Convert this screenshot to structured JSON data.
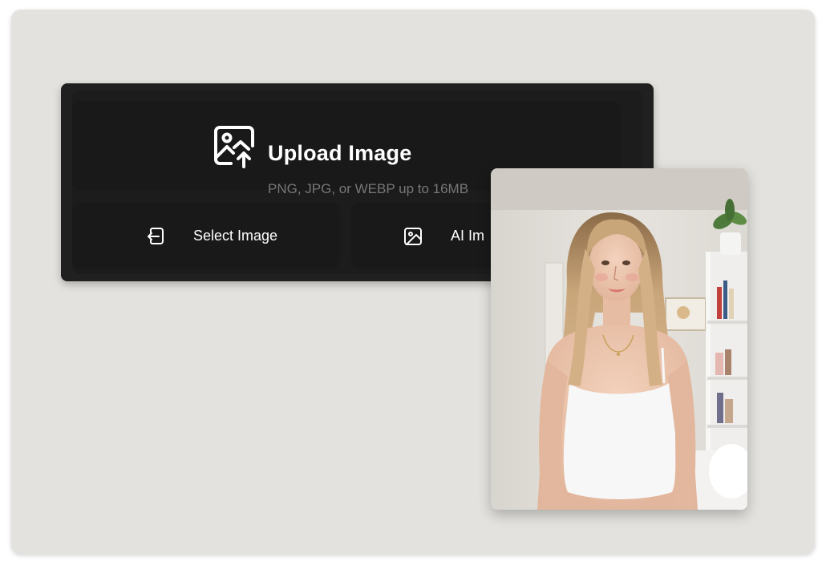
{
  "upload": {
    "title": "Upload Image",
    "subtitle": "PNG, JPG, or WEBP up to 16MB",
    "icon": "image-upload-icon"
  },
  "actions": {
    "select_label": "Select Image",
    "select_icon": "file-import-icon",
    "ai_label": "AI Im",
    "ai_icon": "image-icon"
  },
  "preview": {
    "alt": "Example photo of a woman in a white crop top",
    "accent_colors": {
      "background": "#e3e2de",
      "panel": "#202020",
      "card": "#191919",
      "subtitle": "#777777"
    }
  }
}
